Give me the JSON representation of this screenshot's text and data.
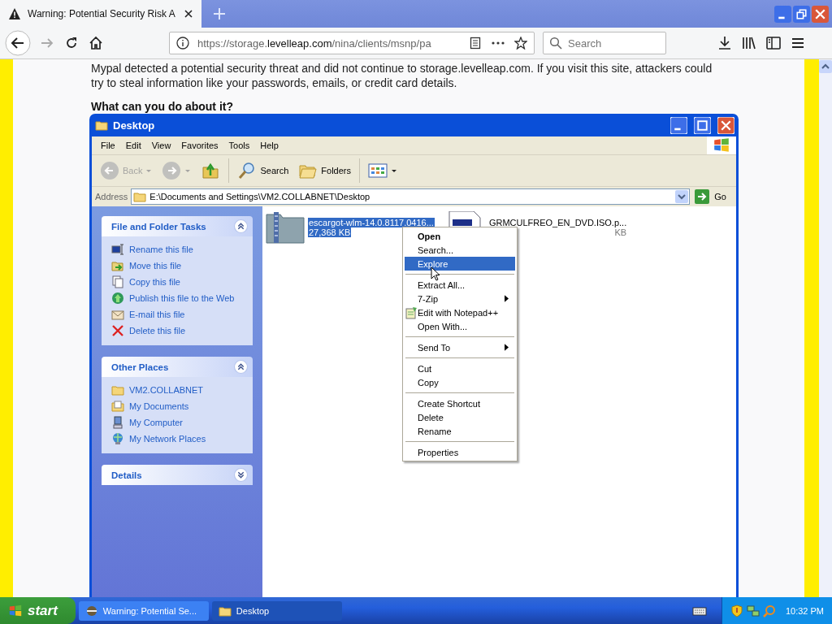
{
  "browser": {
    "tab": {
      "title": "Warning: Potential Security Risk A",
      "selected": true
    },
    "url": {
      "host_prefix": "https://storage.",
      "host": "levelleap.com",
      "path": "/nina/clients/msnp/pa"
    },
    "search": {
      "placeholder": "Search"
    }
  },
  "page": {
    "paragraph": "Mypal detected a potential security threat and did not continue to storage.levelleap.com. If you visit this site, attackers could try to steal information like your passwords, emails, or credit card details.",
    "heading": "What can you do about it?"
  },
  "explorer": {
    "title": "Desktop",
    "menu": [
      "File",
      "Edit",
      "View",
      "Favorites",
      "Tools",
      "Help"
    ],
    "toolbar": [
      {
        "kind": "back",
        "label": "Back",
        "disabled": true
      },
      {
        "kind": "forward",
        "disabled": true
      },
      {
        "kind": "up"
      },
      {
        "kind": "search",
        "label": "Search"
      },
      {
        "kind": "folders",
        "label": "Folders"
      },
      {
        "kind": "views"
      }
    ],
    "address": {
      "label": "Address",
      "value": "E:\\Documents and Settings\\VM2.COLLABNET\\Desktop",
      "go": "Go"
    },
    "panels": [
      {
        "title": "File and Folder Tasks",
        "expanded": true,
        "items": [
          {
            "kind": "rename",
            "label": "Rename this file"
          },
          {
            "kind": "move",
            "label": "Move this file"
          },
          {
            "kind": "copy",
            "label": "Copy this file"
          },
          {
            "kind": "publish",
            "label": "Publish this file to the Web"
          },
          {
            "kind": "email",
            "label": "E-mail this file"
          },
          {
            "kind": "delete",
            "label": "Delete this file"
          }
        ]
      },
      {
        "title": "Other Places",
        "expanded": true,
        "items": [
          {
            "kind": "folder",
            "label": "VM2.COLLABNET"
          },
          {
            "kind": "documents",
            "label": "My Documents"
          },
          {
            "kind": "computer",
            "label": "My Computer"
          },
          {
            "kind": "network",
            "label": "My Network Places"
          }
        ]
      },
      {
        "title": "Details",
        "expanded": false
      }
    ],
    "files": [
      {
        "kind": "zip",
        "name": "escargot-wlm-14.0.8117.0416...",
        "size": "27,368 KB",
        "selected": true
      },
      {
        "kind": "iso",
        "name": "GRMCULFREO_EN_DVD.ISO.p...",
        "size": "KB",
        "selected": false
      }
    ],
    "context_menu": [
      {
        "label": "Open",
        "bold": true,
        "selected": false,
        "submenu": false,
        "icon": false
      },
      {
        "label": "Search...",
        "bold": false,
        "selected": false,
        "submenu": false,
        "icon": false
      },
      {
        "label": "Explore",
        "bold": false,
        "selected": true,
        "submenu": false,
        "icon": false
      },
      {
        "kind": "separator"
      },
      {
        "label": "Extract All...",
        "bold": false,
        "selected": false,
        "submenu": false,
        "icon": false
      },
      {
        "label": "7-Zip",
        "bold": false,
        "selected": false,
        "submenu": true,
        "icon": false
      },
      {
        "label": "Edit with Notepad++",
        "bold": false,
        "selected": false,
        "submenu": false,
        "icon": true
      },
      {
        "label": "Open With...",
        "bold": false,
        "selected": false,
        "submenu": false,
        "icon": false
      },
      {
        "kind": "separator"
      },
      {
        "label": "Send To",
        "bold": false,
        "selected": false,
        "submenu": true,
        "icon": false
      },
      {
        "kind": "separator"
      },
      {
        "label": "Cut",
        "bold": false,
        "selected": false,
        "submenu": false,
        "icon": false
      },
      {
        "label": "Copy",
        "bold": false,
        "selected": false,
        "submenu": false,
        "icon": false
      },
      {
        "kind": "separator"
      },
      {
        "label": "Create Shortcut",
        "bold": false,
        "selected": false,
        "submenu": false,
        "icon": false
      },
      {
        "label": "Delete",
        "bold": false,
        "selected": false,
        "submenu": false,
        "icon": false
      },
      {
        "label": "Rename",
        "bold": false,
        "selected": false,
        "submenu": false,
        "icon": false
      },
      {
        "kind": "separator"
      },
      {
        "label": "Properties",
        "bold": false,
        "selected": false,
        "submenu": false,
        "icon": false
      }
    ]
  },
  "taskbar": {
    "start": "start",
    "tasks": [
      {
        "kind": "browser",
        "label": "Warning: Potential Se...",
        "selected": false
      },
      {
        "kind": "folder",
        "label": "Desktop",
        "selected": true
      }
    ],
    "clock": "10:32 PM"
  }
}
